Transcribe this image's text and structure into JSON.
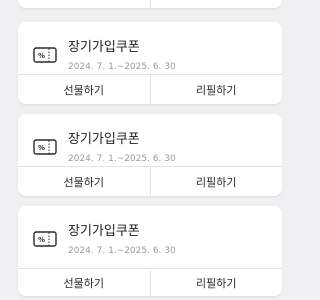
{
  "coupons": [
    {
      "title": "장기가입쿠폰",
      "period": "2024. 7. 1.~2025. 6. 30",
      "gift_label": "선물하기",
      "refill_label": "리필하기"
    },
    {
      "title": "장기가입쿠폰",
      "period": "2024. 7. 1.~2025. 6. 30",
      "gift_label": "선물하기",
      "refill_label": "리필하기"
    },
    {
      "title": "장기가입쿠폰",
      "period": "2024. 7. 1.~2025. 6. 30",
      "gift_label": "선물하기",
      "refill_label": "리필하기"
    }
  ],
  "icons": {
    "coupon": "coupon-ticket-icon"
  },
  "colors": {
    "background": "#f0f0f2",
    "card": "#ffffff",
    "divider": "#e4e4e7",
    "title_text": "#1f1f1f",
    "period_text": "#9a9aa0"
  }
}
